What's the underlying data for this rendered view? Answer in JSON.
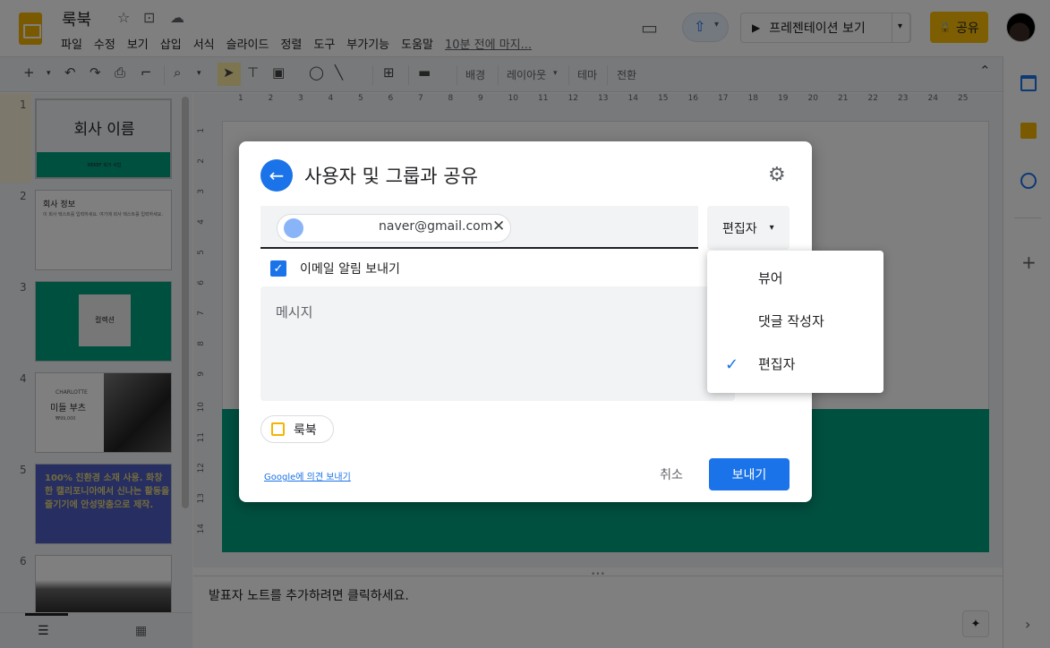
{
  "app": {
    "doc_title": "룩북",
    "menu": [
      "파일",
      "수정",
      "보기",
      "삽입",
      "서식",
      "슬라이드",
      "정렬",
      "도구",
      "부가기능",
      "도움말"
    ],
    "last_edit": "10분 전에 마지...",
    "present_label": "프레젠테이션 보기",
    "share_label": "공유"
  },
  "toolbar": {
    "background_label": "배경",
    "layout_label": "레이아웃",
    "theme_label": "테마",
    "transition_label": "전환"
  },
  "ruler": {
    "h_ticks": [
      "1",
      "2",
      "3",
      "4",
      "5",
      "6",
      "7",
      "8",
      "9",
      "10",
      "11",
      "12",
      "13",
      "14",
      "15",
      "16",
      "17",
      "18",
      "19",
      "20",
      "21",
      "22",
      "23",
      "24",
      "25"
    ],
    "v_ticks": [
      "1",
      "2",
      "3",
      "4",
      "5",
      "6",
      "7",
      "8",
      "9",
      "10",
      "11",
      "12",
      "13",
      "14"
    ]
  },
  "slides": [
    {
      "num": "1",
      "title": "회사 이름",
      "sub": "REKEF 워크 사업"
    },
    {
      "num": "2",
      "title": "회사 정보",
      "body": "이 회사 텍스트를 입력하세요. 여기에 회사 텍스트를 입력하세요."
    },
    {
      "num": "3",
      "title": "컬렉션"
    },
    {
      "num": "4",
      "title": "CHARLOTTE",
      "sub": "미들 부츠",
      "sub2": "₩99,000"
    },
    {
      "num": "5",
      "body": "100% 친환경 소재 사용. 화창한 캘리포니아에서 신나는 활동을 즐기기에 안성맞춤으로 제작."
    },
    {
      "num": "6"
    }
  ],
  "notes_placeholder": "발표자 노트를 추가하려면 클릭하세요.",
  "dialog": {
    "title": "사용자 및 그룹과 공유",
    "chip_email": "naver@gmail.com",
    "role": "편집자",
    "notify_label": "이메일 알림 보내기",
    "notify_checked": true,
    "message_placeholder": "메시지",
    "file_chip": "룩북",
    "feedback_link": "Google에 의견 보내기",
    "cancel_label": "취소",
    "send_label": "보내기"
  },
  "role_menu": {
    "items": [
      "뷰어",
      "댓글 작성자",
      "편집자"
    ],
    "selected": "편집자"
  },
  "colors": {
    "accent": "#1a73e8",
    "share": "#fbbc04",
    "slide_green": "#00a080",
    "purple": "#4d5cc4"
  }
}
